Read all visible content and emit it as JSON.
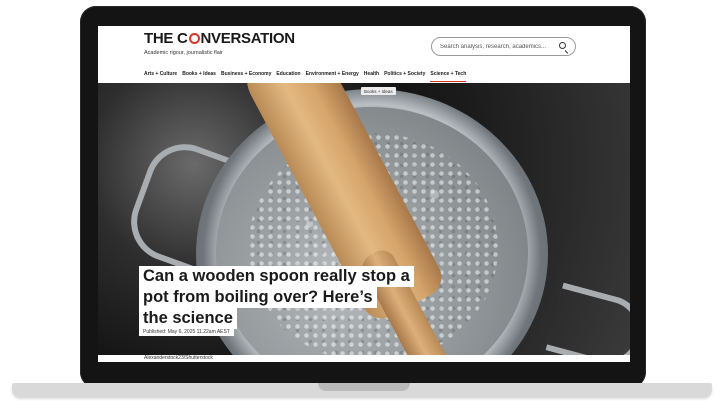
{
  "site": {
    "logo_before": "THE C",
    "logo_after": "NVERSATION",
    "tagline": "Academic rigour, journalistic flair",
    "accent_color": "#d8352a"
  },
  "search": {
    "placeholder": "Search analysis, research, academics...",
    "icon": "search-icon"
  },
  "nav": {
    "items": [
      "Arts + Culture",
      "Books + Ideas",
      "Business + Economy",
      "Education",
      "Environment + Energy",
      "Health",
      "Politics + Society",
      "Science + Tech"
    ],
    "active": "Science + Tech"
  },
  "article": {
    "category": "Books + Ideas",
    "headline_lines": [
      "Can a wooden spoon really stop a",
      "pot from boiling over? Here’s",
      "the science"
    ],
    "published": "Published: May 6, 2025 11.22am AEST",
    "image_credit": "Alexanderstock23/Shutterstock"
  }
}
